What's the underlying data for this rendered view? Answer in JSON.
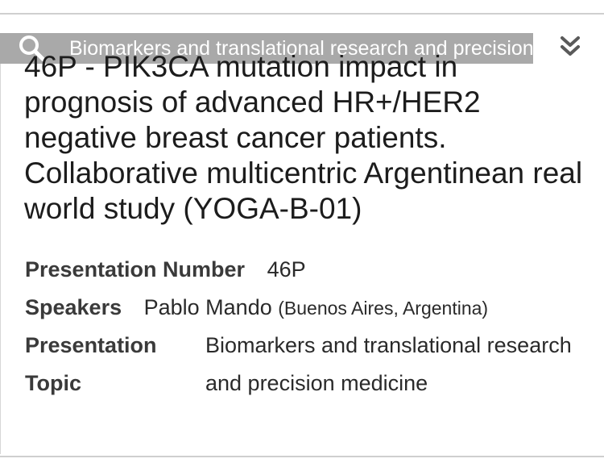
{
  "topic_bar": {
    "text": "Biomarkers and translational research and precision medicine"
  },
  "abstract": {
    "title": "46P - PIK3CA mutation impact in\nprognosis of advanced HR+/HER2\nnegative breast cancer patients.\nCollaborative multicentric Argentinean real\nworld study (YOGA-B-01)"
  },
  "meta": {
    "presentation_number_label": "Presentation Number",
    "presentation_number": "46P",
    "speakers_label": "Speakers",
    "speaker_name": "Pablo Mando",
    "speaker_location": "(Buenos Aires, Argentina)",
    "topic_label_line1": "Presentation",
    "topic_label_line2": "Topic",
    "topic_line1": "Biomarkers and translational research",
    "topic_line2": "and precision medicine"
  },
  "icons": {
    "search": "search-icon",
    "expand": "chevron-double-down-icon"
  },
  "colors": {
    "topic_bar_bg": "#a9a9a9",
    "topic_bar_text": "#ffffff",
    "text": "#1c1c1c"
  }
}
